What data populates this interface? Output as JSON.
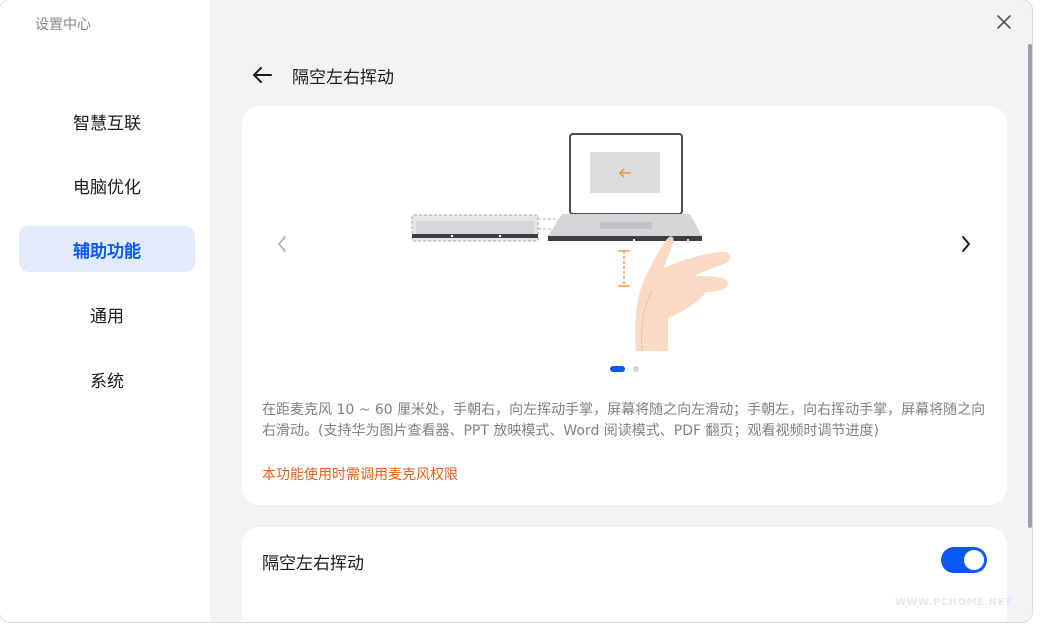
{
  "app": {
    "title": "设置中心"
  },
  "sidebar": {
    "items": [
      {
        "label": "智慧互联"
      },
      {
        "label": "电脑优化"
      },
      {
        "label": "辅助功能"
      },
      {
        "label": "通用"
      },
      {
        "label": "系统"
      }
    ],
    "active_index": 2
  },
  "page": {
    "title": "隔空左右挥动",
    "description": "在距麦克风 10 ~ 60 厘米处，手朝右，向左挥动手掌，屏幕将随之向左滑动；手朝左，向右挥动手掌，屏幕将随之向右滑动。(支持华为图片查看器、PPT 放映模式、Word 阅读模式、PDF 翻页；观看视频时调节进度)",
    "warning": "本功能使用时需调用麦克风权限",
    "carousel": {
      "current": 1,
      "total": 2
    }
  },
  "setting_row": {
    "label": "隔空左右挥动",
    "enabled": true
  },
  "watermark": "WWW.PCHOME.NET",
  "colors": {
    "accent": "#0a59f7",
    "active_bg": "#e2ebfb",
    "warning": "#e5621a",
    "page_bg": "#f1f3f5"
  },
  "icons": {
    "close": "close-icon",
    "back": "back-arrow-icon",
    "prev": "chevron-left-icon",
    "next": "chevron-right-icon"
  }
}
